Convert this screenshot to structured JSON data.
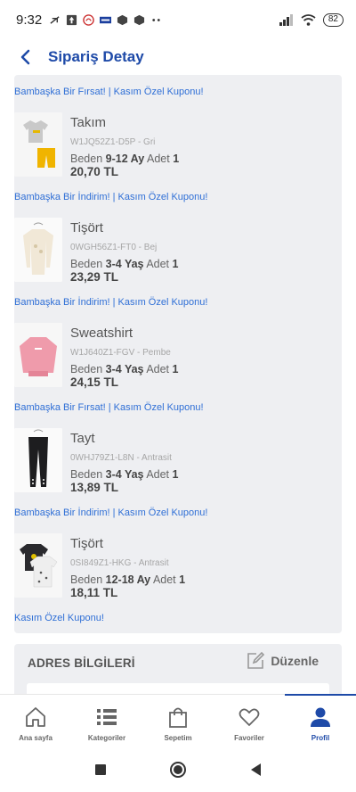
{
  "status_bar": {
    "time": "9:32",
    "battery": "82"
  },
  "header": {
    "title": "Sipariş Detay"
  },
  "promo_texts": [
    "Bambaşka Bir Fırsat! | Kasım Özel Kuponu!",
    "Bambaşka Bir İndirim! | Kasım Özel Kuponu!",
    "Bambaşka Bir İndirim! | Kasım Özel Kuponu!",
    "Bambaşka Bir Fırsat! | Kasım Özel Kuponu!",
    "Bambaşka Bir İndirim! | Kasım Özel Kuponu!",
    "Kasım Özel Kuponu!"
  ],
  "items": [
    {
      "name": "Takım",
      "code": "W1JQ52Z1-D5P - Gri",
      "size_label": "Beden",
      "size": "9-12 Ay",
      "qty_label": "Adet",
      "qty": "1",
      "price": "20,70 TL"
    },
    {
      "name": "Tişört",
      "code": "0WGH56Z1-FT0 - Bej",
      "size_label": "Beden",
      "size": "3-4 Yaş",
      "qty_label": "Adet",
      "qty": "1",
      "price": "23,29 TL"
    },
    {
      "name": "Sweatshirt",
      "code": "W1J640Z1-FGV - Pembe",
      "size_label": "Beden",
      "size": "3-4 Yaş",
      "qty_label": "Adet",
      "qty": "1",
      "price": "24,15 TL"
    },
    {
      "name": "Tayt",
      "code": "0WHJ79Z1-L8N - Antrasit",
      "size_label": "Beden",
      "size": "3-4 Yaş",
      "qty_label": "Adet",
      "qty": "1",
      "price": "13,89 TL"
    },
    {
      "name": "Tişört",
      "code": "0SI849Z1-HKG - Antrasit",
      "size_label": "Beden",
      "size": "12-18 Ay",
      "qty_label": "Adet",
      "qty": "1",
      "price": "18,11 TL"
    }
  ],
  "address": {
    "title": "ADRES BİLGİLERİ",
    "edit_label": "Düzenle"
  },
  "bottom_nav": [
    {
      "label": "Ana sayfa",
      "icon": "home-icon"
    },
    {
      "label": "Kategoriler",
      "icon": "categories-icon"
    },
    {
      "label": "Sepetim",
      "icon": "bag-icon"
    },
    {
      "label": "Favoriler",
      "icon": "heart-icon"
    },
    {
      "label": "Profil",
      "icon": "profile-icon"
    }
  ],
  "colors": {
    "brand": "#1e4aa8",
    "promo": "#2f6fd6",
    "panel": "#eeeff2"
  }
}
